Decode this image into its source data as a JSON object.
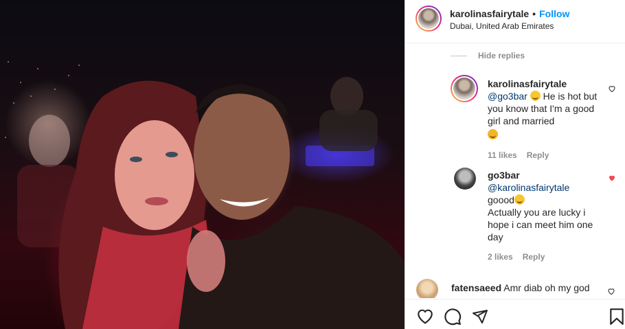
{
  "header": {
    "username": "karolinasfairytale",
    "separator": "•",
    "follow_label": "Follow",
    "location": "Dubai, United Arab Emirates"
  },
  "comments": {
    "hide_replies_label": "Hide replies",
    "reply_label": "Reply",
    "items": [
      {
        "username": "karolinasfairytale",
        "mention": "@go3bar",
        "text": "He is hot but you know that I'm a good girl and married",
        "likes": "11 likes",
        "liked": false
      },
      {
        "username": "go3bar",
        "mention": "@karolinasfairytale",
        "text_line1": "goood",
        "text_line2": "Actually you are lucky i hope i can meet him one day",
        "likes": "2 likes",
        "liked": true
      },
      {
        "username": "fatensaeed",
        "text": "Amr diab oh my god",
        "liked": false
      }
    ]
  },
  "colors": {
    "follow_blue": "#0095f6",
    "mention_blue": "#00376b",
    "liked_red": "#ed4956",
    "muted_gray": "#8e8e8e"
  },
  "icons": [
    "heart-icon",
    "comment-icon",
    "share-icon",
    "bookmark-icon"
  ]
}
